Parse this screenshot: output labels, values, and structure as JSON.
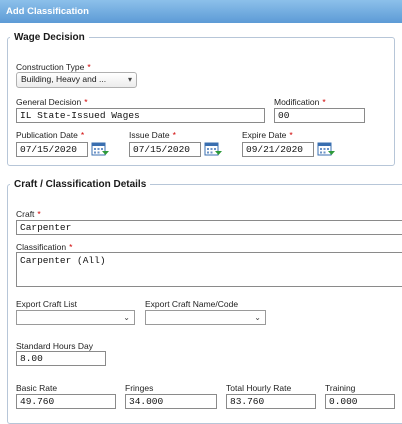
{
  "window": {
    "title": "Add Classification"
  },
  "wage_decision": {
    "legend": "Wage Decision",
    "construction_type": {
      "label": "Construction Type",
      "value": "Building, Heavy and ..."
    },
    "general_decision": {
      "label": "General Decision",
      "value": "IL State-Issued Wages"
    },
    "modification": {
      "label": "Modification",
      "value": "00"
    },
    "publication_date": {
      "label": "Publication Date",
      "value": "07/15/2020"
    },
    "issue_date": {
      "label": "Issue Date",
      "value": "07/15/2020"
    },
    "expire_date": {
      "label": "Expire Date",
      "value": "09/21/2020"
    }
  },
  "craft_details": {
    "legend": "Craft / Classification Details",
    "craft": {
      "label": "Craft",
      "value": "Carpenter"
    },
    "classification": {
      "label": "Classification",
      "value": "Carpenter (All)"
    },
    "export_craft_list": {
      "label": "Export Craft List",
      "value": ""
    },
    "export_craft_name_code": {
      "label": "Export Craft Name/Code",
      "value": ""
    },
    "standard_hours_day": {
      "label": "Standard Hours Day",
      "value": "8.00"
    },
    "basic_rate": {
      "label": "Basic Rate",
      "value": "49.760"
    },
    "fringes": {
      "label": "Fringes",
      "value": "34.000"
    },
    "total_hourly_rate": {
      "label": "Total Hourly Rate",
      "value": "83.760"
    },
    "training": {
      "label": "Training",
      "value": "0.000"
    }
  },
  "required_marker": "*",
  "icons": {
    "calendar": "calendar-icon",
    "dropdown": "chevron-down-icon"
  },
  "colors": {
    "titlebar": "#6aa6dd",
    "required": "#d00000",
    "fieldset_border": "#b7c6d8"
  }
}
